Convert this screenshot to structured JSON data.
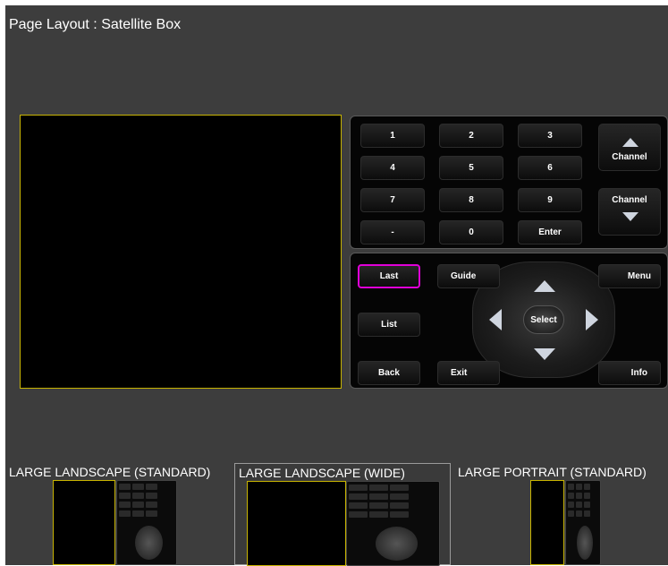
{
  "page": {
    "title": "Page Layout : Satellite Box"
  },
  "remote": {
    "numpad": [
      {
        "label": "1",
        "name": "key-1"
      },
      {
        "label": "2",
        "name": "key-2"
      },
      {
        "label": "3",
        "name": "key-3"
      },
      {
        "label": "4",
        "name": "key-4"
      },
      {
        "label": "5",
        "name": "key-5"
      },
      {
        "label": "6",
        "name": "key-6"
      },
      {
        "label": "7",
        "name": "key-7"
      },
      {
        "label": "8",
        "name": "key-8"
      },
      {
        "label": "9",
        "name": "key-9"
      },
      {
        "label": "-",
        "name": "key-dash"
      },
      {
        "label": "0",
        "name": "key-0"
      },
      {
        "label": "Enter",
        "name": "key-enter"
      }
    ],
    "channel_up_label": "Channel",
    "channel_down_label": "Channel",
    "nav": {
      "last": "Last",
      "guide": "Guide",
      "menu": "Menu",
      "list": "List",
      "select": "Select",
      "back": "Back",
      "exit": "Exit",
      "info": "Info"
    },
    "selected_key": "Last",
    "highlight_color": "#e000d8",
    "screen_border_color": "#c8b400"
  },
  "layouts": [
    {
      "label": "LARGE LANDSCAPE (STANDARD)",
      "active": false
    },
    {
      "label": "LARGE LANDSCAPE (WIDE)",
      "active": true
    },
    {
      "label": "LARGE PORTRAIT (STANDARD)",
      "active": false
    }
  ]
}
